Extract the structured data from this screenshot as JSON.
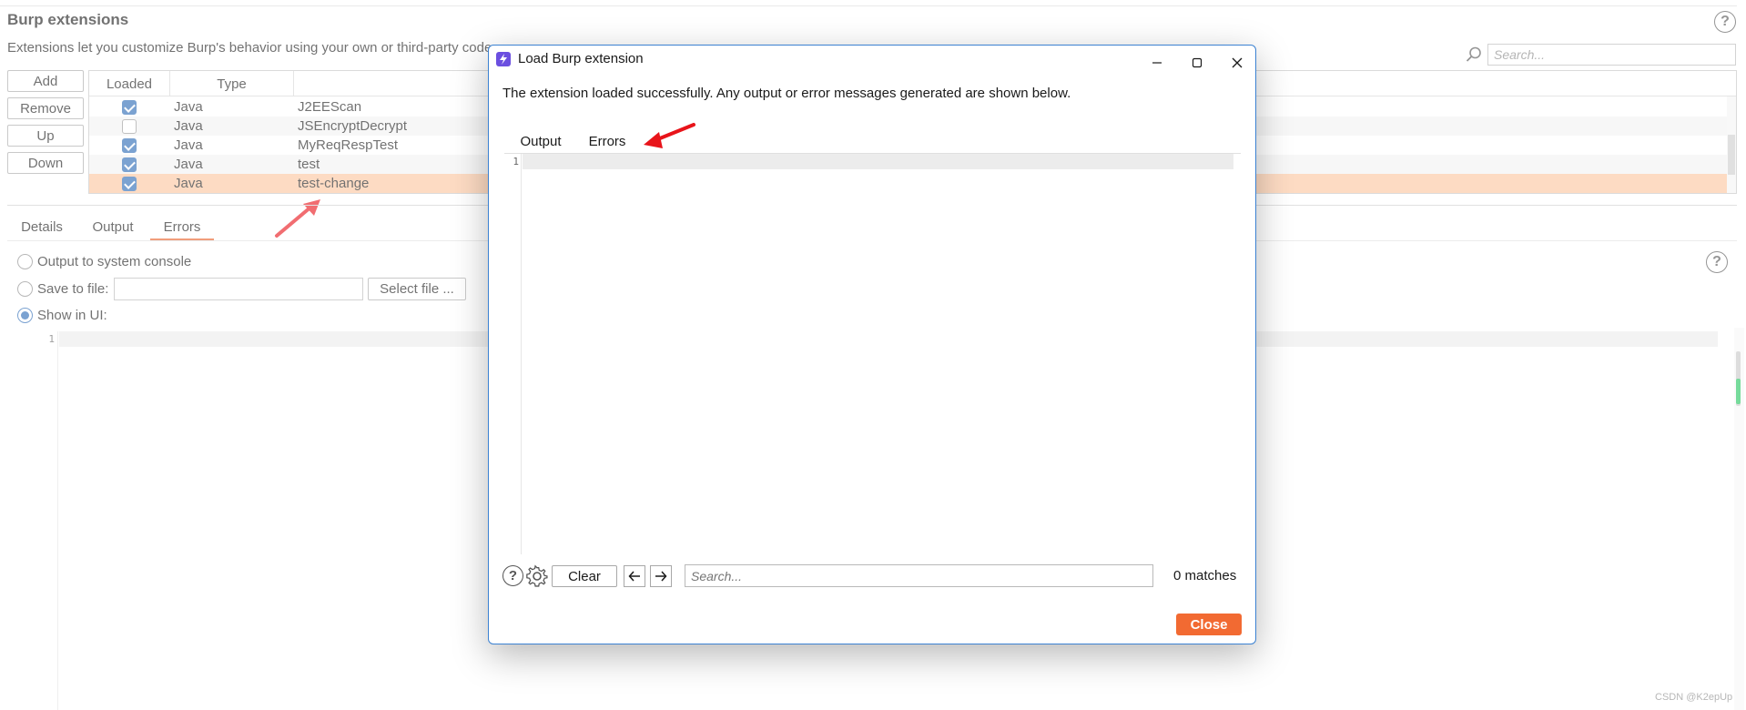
{
  "page": {
    "title": "Burp extensions",
    "description": "Extensions let you customize Burp's behavior using your own or third-party code",
    "search_placeholder": "Search..."
  },
  "side_buttons": {
    "add": "Add",
    "remove": "Remove",
    "up": "Up",
    "down": "Down"
  },
  "table": {
    "headers": {
      "loaded": "Loaded",
      "type": "Type"
    },
    "rows": [
      {
        "loaded": true,
        "type": "Java",
        "name": "J2EEScan"
      },
      {
        "loaded": false,
        "type": "Java",
        "name": "JSEncryptDecrypt"
      },
      {
        "loaded": true,
        "type": "Java",
        "name": "MyReqRespTest"
      },
      {
        "loaded": true,
        "type": "Java",
        "name": "test"
      },
      {
        "loaded": true,
        "type": "Java",
        "name": "test-change",
        "selected": true
      }
    ]
  },
  "detail_tabs": {
    "details": "Details",
    "output": "Output",
    "errors": "Errors",
    "active": "errors"
  },
  "output_options": {
    "system_console": "Output to system console",
    "save_to_file": "Save to file:",
    "select_file": "Select file ...",
    "show_in_ui": "Show in UI:",
    "selected": "show_in_ui"
  },
  "editor": {
    "line_number": "1"
  },
  "dialog": {
    "title": "Load Burp extension",
    "message": "The extension loaded successfully. Any output or error messages generated are shown below.",
    "tabs": {
      "output": "Output",
      "errors": "Errors",
      "active": "errors"
    },
    "line_number": "1",
    "clear_label": "Clear",
    "search_placeholder": "Search...",
    "matches": "0 matches",
    "close_label": "Close"
  },
  "watermark": "CSDN @K2epUp",
  "colors": {
    "accent": "#e8622a",
    "selected_row": "#fcc69f",
    "checkbox": "#2a6ab5",
    "close_button": "#f26a32",
    "arrow": "#e8141a"
  },
  "icons": [
    "help-icon",
    "search-icon",
    "burp-logo-icon",
    "minimize-icon",
    "maximize-icon",
    "close-icon",
    "settings-icon",
    "arrow-left-icon",
    "arrow-right-icon"
  ]
}
